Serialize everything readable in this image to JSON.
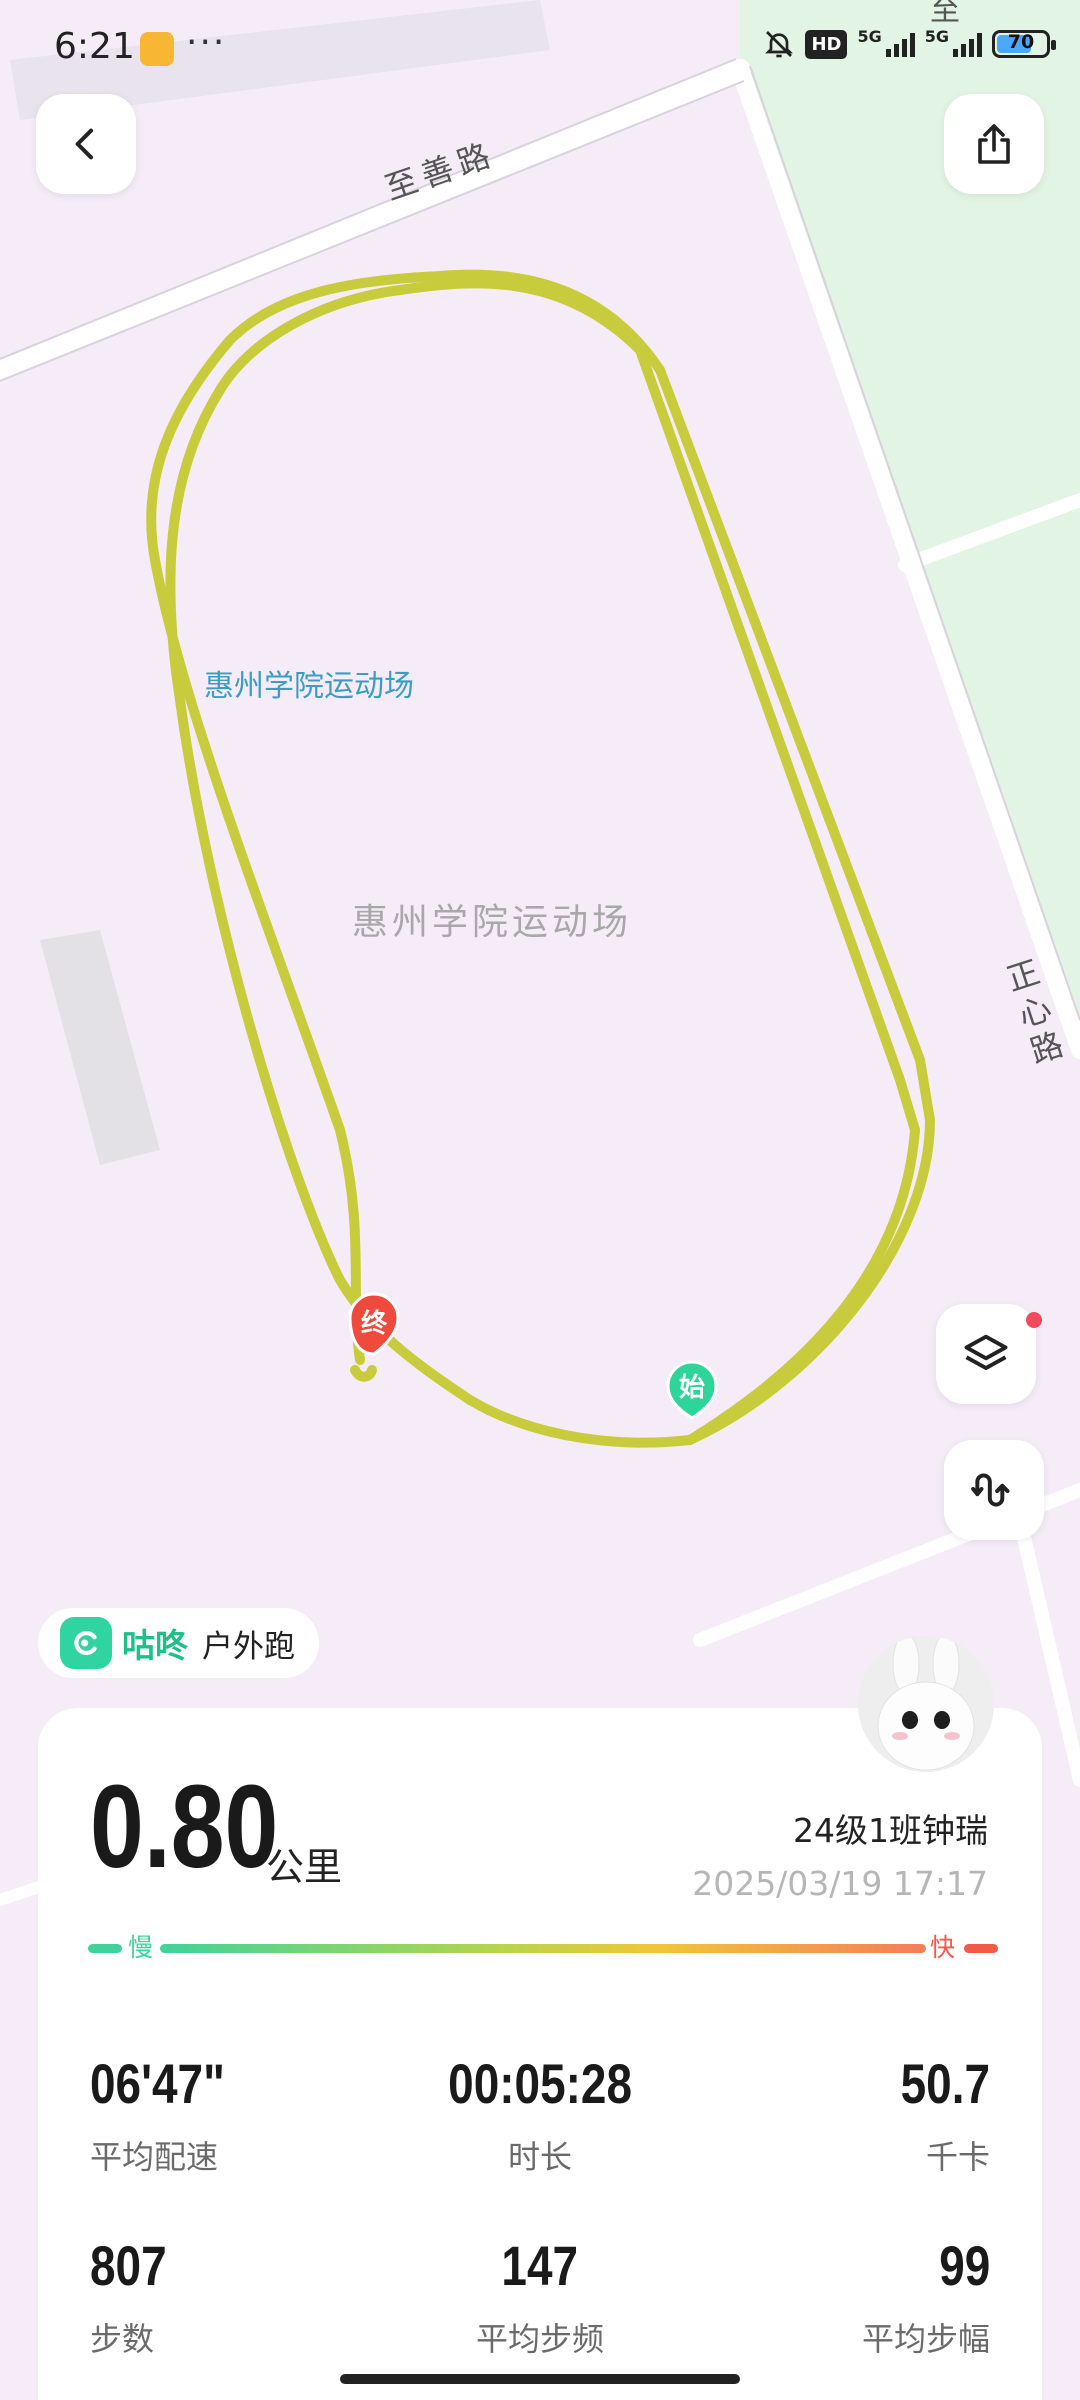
{
  "status_bar": {
    "time": "6:21",
    "more": "···",
    "hd_badge": "HD",
    "network_1": "5G",
    "network_2": "5G",
    "battery": "70"
  },
  "map": {
    "road_top": "至善路",
    "road_right": "正心路",
    "road_corner": "至",
    "poi_label": "惠州学院运动场",
    "area_label": "惠州学院运动场",
    "end_marker": "终",
    "start_marker": "始",
    "track_color": "#c8cc3c"
  },
  "app": {
    "brand": "咕咚",
    "mode": "户外跑"
  },
  "summary": {
    "distance": "0.80",
    "distance_unit": "公里",
    "user_name": "24级1班钟瑞",
    "date": "2025/03/19 17:17",
    "pace_slow": "慢",
    "pace_fast": "快"
  },
  "stats": [
    {
      "value": "06'47\"",
      "label": "平均配速"
    },
    {
      "value": "00:05:28",
      "label": "时长"
    },
    {
      "value": "50.7",
      "label": "千卡"
    },
    {
      "value": "807",
      "label": "步数"
    },
    {
      "value": "147",
      "label": "平均步频"
    },
    {
      "value": "99",
      "label": "平均步幅"
    }
  ],
  "colors": {
    "accent": "#1fbf8a",
    "map_bg": "#f5ecf8",
    "park": "#e3f4e4",
    "slow": "#3fd39b",
    "fast": "#f25a47"
  }
}
